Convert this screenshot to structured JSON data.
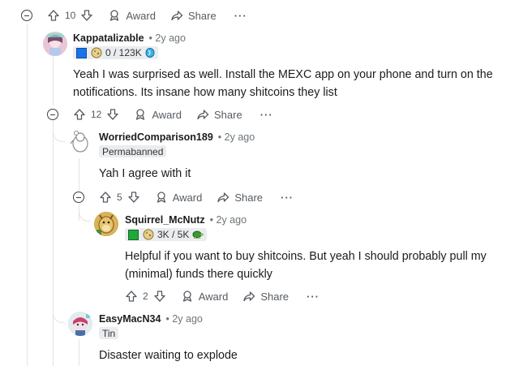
{
  "actions_labels": {
    "award": "Award",
    "share": "Share",
    "more": "···"
  },
  "top_actions": {
    "votes": "10"
  },
  "comments": [
    {
      "author": "Kappatalizable",
      "time": "2y ago",
      "flair": "0 / 123K",
      "body": "Yeah I was surprised as well. Install the MEXC app on your phone and turn on the notifications. Its insane how many shitcoins they list",
      "votes": "12"
    },
    {
      "author": "WorriedComparison189",
      "time": "2y ago",
      "flair": "Permabanned",
      "body": "Yah I agree with it",
      "votes": "5"
    },
    {
      "author": "Squirrel_McNutz",
      "time": "2y ago",
      "flair": "3K / 5K",
      "body": "Helpful if you want to buy shitcoins. But yeah I should probably pull my (minimal) funds there quickly",
      "votes": "2"
    },
    {
      "author": "EasyMacN34",
      "time": "2y ago",
      "flair": "Tin",
      "body": "Disaster waiting to explode"
    }
  ],
  "colors": {
    "thread_line": "#e0e3e6",
    "flair_bg": "#eaedef",
    "meta": "#6e757a",
    "action": "#555b61"
  }
}
